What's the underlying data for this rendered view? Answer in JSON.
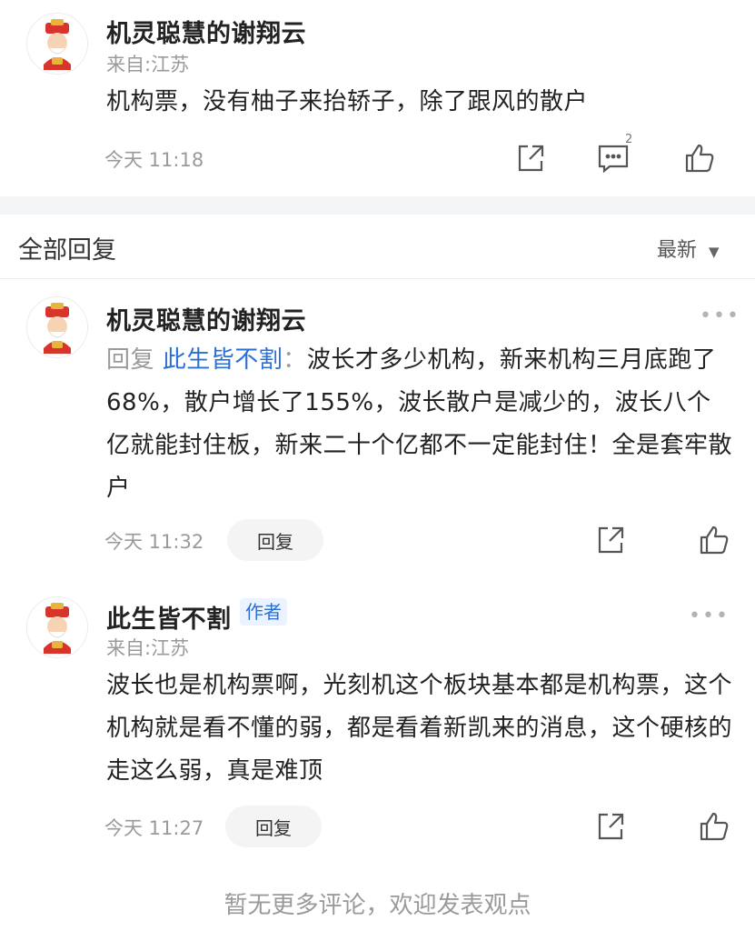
{
  "post": {
    "author": "机灵聪慧的谢翔云",
    "location": "来自:江苏",
    "content": "机构票，没有柚子来抬轿子，除了跟风的散户",
    "time": "今天 11:18",
    "comment_count": "2"
  },
  "replies_section": {
    "title": "全部回复",
    "sort_label": "最新",
    "sort_icon": "caret-down-icon"
  },
  "replies": [
    {
      "author": "机灵聪慧的谢翔云",
      "reply_prefix": "回复",
      "reply_to": "此生皆不割",
      "separator": "：",
      "content": "波长才多少机构，新来机构三月底跑了68%，散户增长了155%，波长散户是减少的，波长八个亿就能封住板，新来二十个亿都不一定能封住！全是套牢散户",
      "time": "今天 11:32",
      "reply_button": "回复"
    },
    {
      "author": "此生皆不割",
      "badge": "作者",
      "location": "来自:江苏",
      "content": "波长也是机构票啊，光刻机这个板块基本都是机构票，这个机构就是看不懂的弱，都是看着新凯来的消息，这个硬核的走这么弱，真是难顶",
      "time": "今天 11:27",
      "reply_button": "回复"
    }
  ],
  "footer": {
    "note": "暂无更多评论，欢迎发表观点"
  },
  "colors": {
    "accent": "#2a6fd6",
    "muted": "#9a9a9a",
    "band": "#f4f5f7"
  }
}
